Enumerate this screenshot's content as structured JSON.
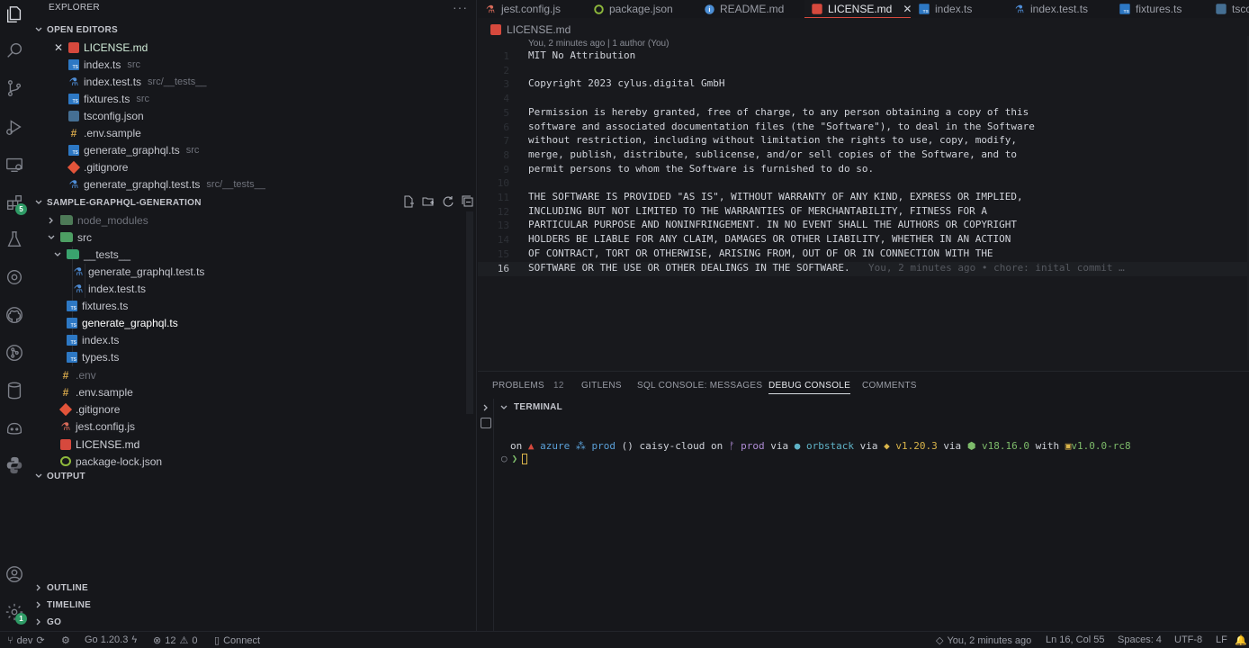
{
  "explorer": {
    "title": "EXPLORER",
    "more": "···",
    "open_editors": {
      "label": "OPEN EDITORS",
      "items": [
        {
          "name": "LICENSE.md",
          "desc": "",
          "icon": "markdown-icon",
          "active": true
        },
        {
          "name": "index.ts",
          "desc": "src",
          "icon": "typescript-icon"
        },
        {
          "name": "index.test.ts",
          "desc": "src/__tests__",
          "icon": "jest-icon"
        },
        {
          "name": "fixtures.ts",
          "desc": "src",
          "icon": "typescript-icon"
        },
        {
          "name": "tsconfig.json",
          "desc": "",
          "icon": "tsconfig-icon"
        },
        {
          "name": ".env.sample",
          "desc": "",
          "icon": "env-icon"
        },
        {
          "name": "generate_graphql.ts",
          "desc": "src",
          "icon": "typescript-icon"
        },
        {
          "name": ".gitignore",
          "desc": "",
          "icon": "git-icon"
        },
        {
          "name": "generate_graphql.test.ts",
          "desc": "src/__tests__",
          "icon": "jest-icon"
        }
      ]
    },
    "project": {
      "label": "SAMPLE-GRAPHQL-GENERATION",
      "tree": [
        {
          "name": "node_modules",
          "type": "folder-closed"
        },
        {
          "name": "src",
          "type": "folder-open"
        },
        {
          "name": "__tests__",
          "type": "folder-open-test"
        },
        {
          "name": "generate_graphql.test.ts",
          "type": "jest"
        },
        {
          "name": "index.test.ts",
          "type": "jest"
        },
        {
          "name": "fixtures.ts",
          "type": "ts"
        },
        {
          "name": "generate_graphql.ts",
          "type": "ts"
        },
        {
          "name": "index.ts",
          "type": "ts"
        },
        {
          "name": "types.ts",
          "type": "ts"
        },
        {
          "name": ".env",
          "type": "env"
        },
        {
          "name": ".env.sample",
          "type": "env"
        },
        {
          "name": ".gitignore",
          "type": "git"
        },
        {
          "name": "jest.config.js",
          "type": "js"
        },
        {
          "name": "LICENSE.md",
          "type": "md"
        },
        {
          "name": "package-lock.json",
          "type": "json"
        }
      ]
    },
    "output": "OUTPUT",
    "outline": "OUTLINE",
    "timeline": "TIMELINE",
    "go": "GO"
  },
  "activity": {
    "extensions_badge": "5",
    "settings_badge": "1"
  },
  "tabs": [
    {
      "label": "jest.config.js",
      "icon": "js-icon"
    },
    {
      "label": "package.json",
      "icon": "npm-icon"
    },
    {
      "label": "README.md",
      "icon": "info-icon"
    },
    {
      "label": "LICENSE.md",
      "icon": "markdown-icon",
      "active": true,
      "close": "✕"
    },
    {
      "label": "index.ts",
      "icon": "typescript-icon"
    },
    {
      "label": "index.test.ts",
      "icon": "jest-icon"
    },
    {
      "label": "fixtures.ts",
      "icon": "typescript-icon"
    },
    {
      "label": "tsco",
      "icon": "tsconfig-icon"
    }
  ],
  "editor": {
    "breadcrumb": "LICENSE.md",
    "blame_header": "You, 2 minutes ago | 1 author (You)",
    "current_line": 16,
    "lines": [
      "MIT No Attribution",
      "",
      "Copyright 2023 cylus.digital GmbH",
      "",
      "Permission is hereby granted, free of charge, to any person obtaining a copy of this",
      "software and associated documentation files (the \"Software\"), to deal in the Software",
      "without restriction, including without limitation the rights to use, copy, modify,",
      "merge, publish, distribute, sublicense, and/or sell copies of the Software, and to",
      "permit persons to whom the Software is furnished to do so.",
      "",
      "THE SOFTWARE IS PROVIDED \"AS IS\", WITHOUT WARRANTY OF ANY KIND, EXPRESS OR IMPLIED,",
      "INCLUDING BUT NOT LIMITED TO THE WARRANTIES OF MERCHANTABILITY, FITNESS FOR A",
      "PARTICULAR PURPOSE AND NONINFRINGEMENT. IN NO EVENT SHALL THE AUTHORS OR COPYRIGHT",
      "HOLDERS BE LIABLE FOR ANY CLAIM, DAMAGES OR OTHER LIABILITY, WHETHER IN AN ACTION",
      "OF CONTRACT, TORT OR OTHERWISE, ARISING FROM, OUT OF OR IN CONNECTION WITH THE",
      "SOFTWARE OR THE USE OR OTHER DEALINGS IN THE SOFTWARE."
    ],
    "inline_blame": "You, 2 minutes ago • chore: inital commit …"
  },
  "panel": {
    "tabs": [
      {
        "label": "PROBLEMS",
        "count": "12"
      },
      {
        "label": "GITLENS"
      },
      {
        "label": "SQL CONSOLE: MESSAGES"
      },
      {
        "label": "DEBUG CONSOLE",
        "active": true
      },
      {
        "label": "COMMENTS"
      }
    ],
    "terminal_label": "TERMINAL",
    "prompt": {
      "on1": "on",
      "azure": "azure",
      "azure_env": "prod",
      "paren": "()",
      "project": "caisy-cloud",
      "on2": "on",
      "branch": "prod",
      "via1": "via",
      "orb": "orbstack",
      "via2": "via",
      "go": "v1.20.3",
      "via3": "via",
      "node": "v18.16.0",
      "with": "with",
      "pkg": "v1.0.0-rc8"
    },
    "prompt_arrow": "❯"
  },
  "status": {
    "branch": "dev",
    "go_version": "Go 1.20.3",
    "errors": "12",
    "warnings": "0",
    "connect": "Connect",
    "blame": "You, 2 minutes ago",
    "position": "Ln 16, Col 55",
    "spaces": "Spaces: 4",
    "encoding": "UTF-8",
    "eol": "LF"
  },
  "colors": {
    "accent": "#d6493d",
    "ts": "#2d78c4",
    "folder": "#4d9e63",
    "badge": "#2e9a65"
  }
}
